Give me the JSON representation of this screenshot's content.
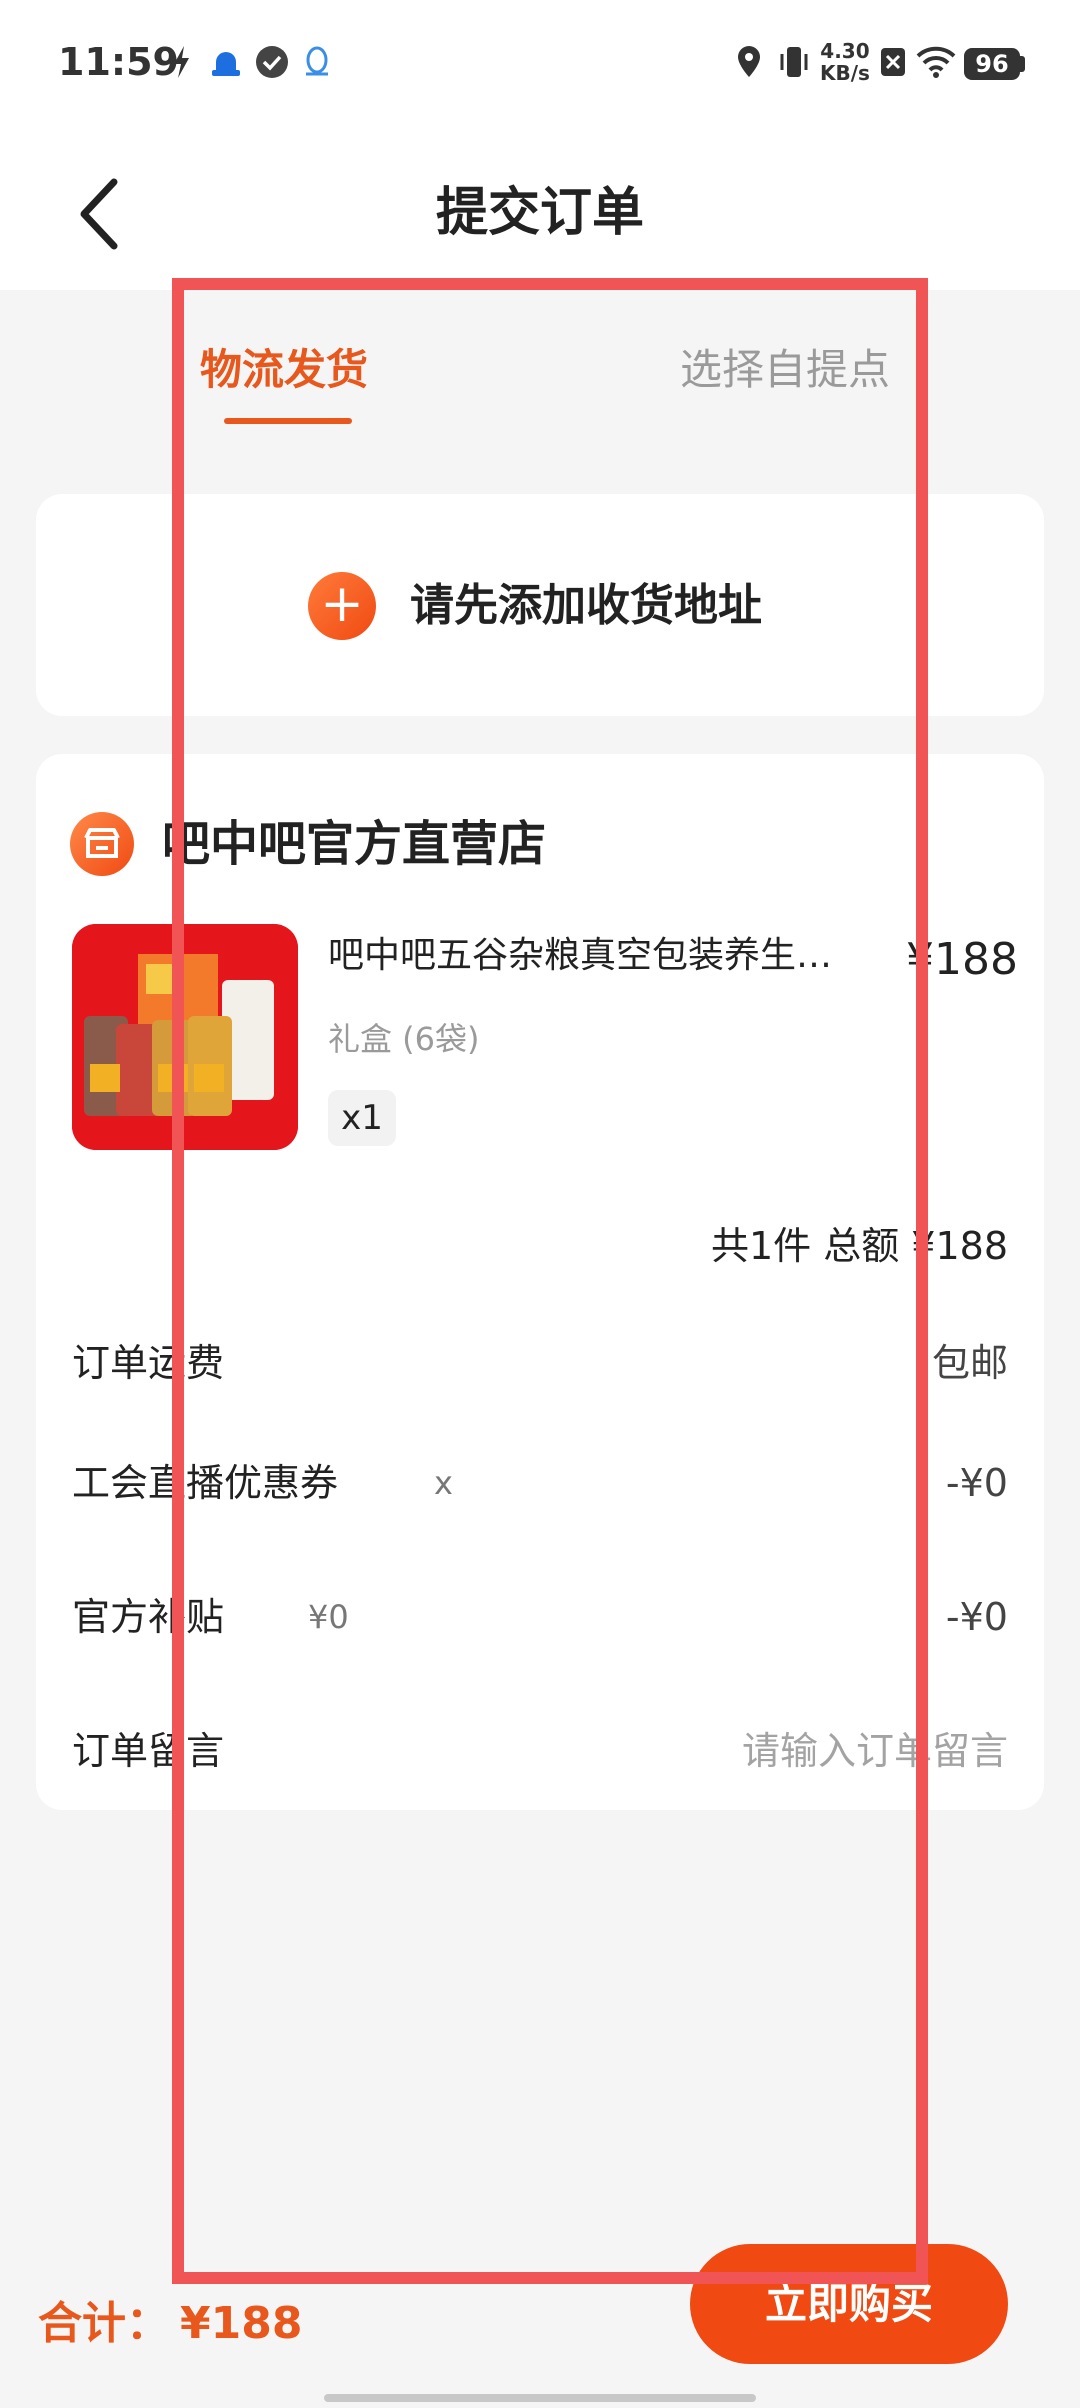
{
  "status_bar": {
    "time": "11:59",
    "net_speed_value": "4.30",
    "net_speed_unit": "KB/s",
    "battery": "96"
  },
  "header": {
    "title": "提交订单"
  },
  "tabs": [
    {
      "label": "物流发货",
      "active": true
    },
    {
      "label": "选择自提点",
      "active": false
    }
  ],
  "address": {
    "add_label": "请先添加收货地址"
  },
  "order": {
    "shop_name": "吧中吧官方直营店",
    "product": {
      "title": "吧中吧五谷杂粮真空包装养生…",
      "price": "¥188",
      "spec": "礼盒 (6袋)",
      "quantity": "x1"
    },
    "summary": "共1件 总额 ¥188",
    "rows": {
      "shipping": {
        "label": "订单运费",
        "value": "包邮"
      },
      "coupon": {
        "label": "工会直播优惠券",
        "extra": "x",
        "value": "-¥0"
      },
      "subsidy": {
        "label": "官方补贴",
        "extra": "¥0",
        "value": "-¥0"
      },
      "note": {
        "label": "订单留言",
        "placeholder": "请输入订单留言"
      }
    }
  },
  "bottom_bar": {
    "total_label": "合计：",
    "total_value": "¥188",
    "buy_label": "立即购买"
  },
  "colors": {
    "accent": "#e8571c",
    "button": "#f04a12",
    "highlight": "#f05455"
  }
}
